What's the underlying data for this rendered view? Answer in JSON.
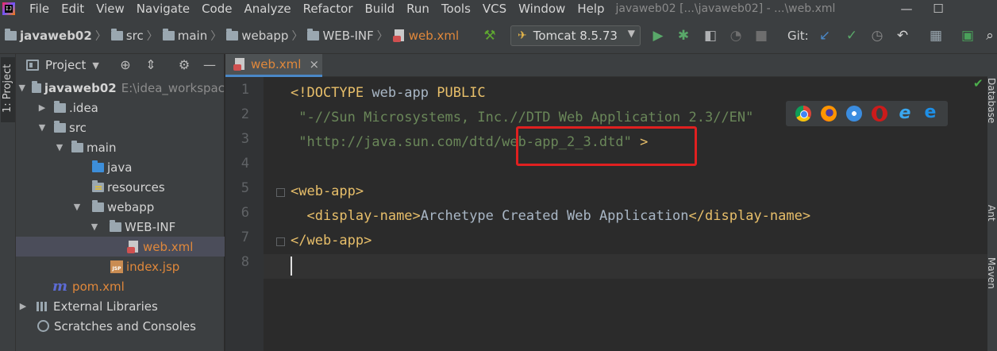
{
  "menu": {
    "items": [
      "File",
      "Edit",
      "View",
      "Navigate",
      "Code",
      "Analyze",
      "Refactor",
      "Build",
      "Run",
      "Tools",
      "VCS",
      "Window",
      "Help"
    ],
    "mnemonics": [
      "F",
      "E",
      "V",
      "N",
      "C",
      "",
      "R",
      "B",
      "R",
      "T",
      "S",
      "W",
      "H"
    ]
  },
  "window": {
    "title": "javaweb02 [...\\javaweb02] - ...\\web.xml",
    "minimize": "—",
    "maximize": "☐"
  },
  "breadcrumb": [
    {
      "label": "javaweb02",
      "icon": "folder-icon"
    },
    {
      "label": "src",
      "icon": "folder-icon"
    },
    {
      "label": "main",
      "icon": "folder-icon"
    },
    {
      "label": "webapp",
      "icon": "web-folder-icon"
    },
    {
      "label": "WEB-INF",
      "icon": "folder-icon"
    },
    {
      "label": "web.xml",
      "icon": "xml-file-icon"
    }
  ],
  "toolbar": {
    "run_config": "Tomcat 8.5.73",
    "git_label": "Git:"
  },
  "left_stripe": {
    "project_label": "1: Project"
  },
  "project_panel": {
    "title": "Project",
    "tree": [
      {
        "label": "javaweb02",
        "path": "E:\\idea_workspac",
        "bold": true,
        "arrow": "▼",
        "icon": "module-folder-icon"
      },
      {
        "label": ".idea",
        "arrow": "▶",
        "icon": "folder-icon"
      },
      {
        "label": "src",
        "arrow": "▼",
        "icon": "folder-icon"
      },
      {
        "label": "main",
        "arrow": "▼",
        "icon": "folder-icon"
      },
      {
        "label": "java",
        "arrow": "",
        "icon": "source-folder-icon"
      },
      {
        "label": "resources",
        "arrow": "",
        "icon": "resources-folder-icon"
      },
      {
        "label": "webapp",
        "arrow": "▼",
        "icon": "web-folder-icon"
      },
      {
        "label": "WEB-INF",
        "arrow": "▼",
        "icon": "folder-icon"
      },
      {
        "label": "web.xml",
        "arrow": "",
        "icon": "xml-file-icon",
        "selected": true
      },
      {
        "label": "index.jsp",
        "arrow": "",
        "icon": "jsp-file-icon"
      },
      {
        "label": "pom.xml",
        "arrow": "",
        "icon": "maven-icon"
      },
      {
        "label": "External Libraries",
        "arrow": "▶",
        "icon": "libraries-icon"
      },
      {
        "label": "Scratches and Consoles",
        "arrow": "",
        "icon": "scratches-icon"
      }
    ]
  },
  "editor": {
    "tab_label": "web.xml",
    "tab_close": "×",
    "line_numbers": [
      "1",
      "2",
      "3",
      "4",
      "5",
      "6",
      "7",
      "8"
    ],
    "lines": {
      "l1": {
        "tag": "<!DOCTYPE",
        "text": " web-app ",
        "tag2": "PUBLIC"
      },
      "l2": {
        "str": " \"-//Sun Microsystems, Inc.//DTD Web Application 2.3//EN\""
      },
      "l3": {
        "str": " \"http://java.sun.com/dtd/web-app_2_3.dtd\"",
        "tag": " >"
      },
      "l5": {
        "tag": "<web-app>"
      },
      "l6": {
        "indent": "  ",
        "open": "<display-name>",
        "text": "Archetype Created Web Application",
        "close": "</display-name>"
      },
      "l7": {
        "tag": "</web-app>"
      }
    }
  },
  "browser_popup": [
    "chrome-icon",
    "firefox-icon",
    "safari-icon",
    "opera-icon",
    "ie-icon",
    "edge-icon"
  ],
  "right_stripe": [
    "Database",
    "Ant",
    "Maven"
  ],
  "colors": {
    "tag": "#e8bf6a",
    "string": "#6a8759",
    "text": "#a9b7c6",
    "highlight_box": "#e02020",
    "selection": "#4b4d5a"
  }
}
